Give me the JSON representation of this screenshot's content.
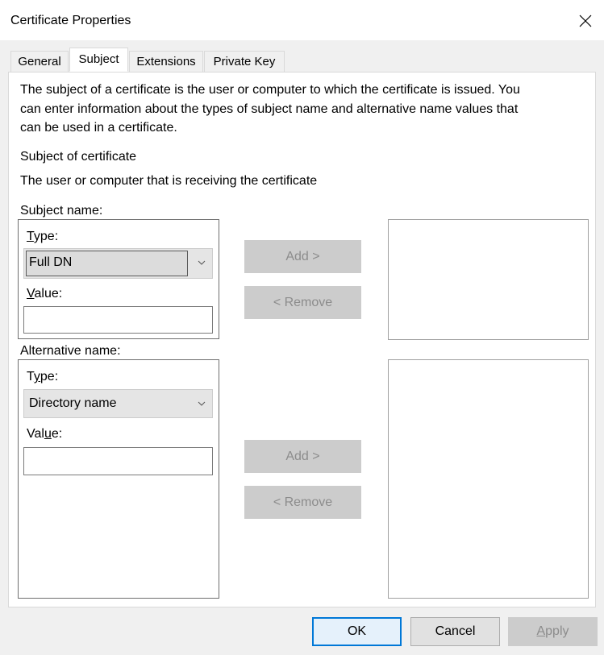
{
  "window": {
    "title": "Certificate Properties"
  },
  "tabs": [
    {
      "label": "General"
    },
    {
      "label": "Subject",
      "active": true
    },
    {
      "label": "Extensions"
    },
    {
      "label": "Private Key"
    }
  ],
  "description": {
    "line1": "The subject of a certificate is the user or computer to which the certificate is issued. You",
    "line2": "can enter information about the types of subject name and alternative name values that",
    "line3": "can be used in a certificate."
  },
  "subject_section": {
    "heading": "Subject of certificate",
    "subtext": "The user or computer that is receiving the certificate"
  },
  "subject_name": {
    "group_label": "Subject name:",
    "type_label_prefix": "",
    "type_label_mnemonic": "T",
    "type_label_suffix": "ype:",
    "type_value": "Full DN",
    "value_label_prefix": "",
    "value_label_mnemonic": "V",
    "value_label_suffix": "alue:",
    "value_input": "",
    "add_button": "Add >",
    "remove_button": "< Remove"
  },
  "alternative_name": {
    "group_label": "Alternative name:",
    "type_label_prefix": "T",
    "type_label_mnemonic": "y",
    "type_label_suffix": "pe:",
    "type_value": "Directory name",
    "value_label_prefix": "Val",
    "value_label_mnemonic": "u",
    "value_label_suffix": "e:",
    "value_input": "",
    "add_button": "Add >",
    "remove_button": "< Remove"
  },
  "footer": {
    "ok": "OK",
    "cancel": "Cancel",
    "apply_mnemonic": "A",
    "apply_rest": "pply"
  },
  "colors": {
    "focus_border": "#0078d7",
    "disabled_button": "#cccccc",
    "disabled_text": "#8c8c8c"
  }
}
